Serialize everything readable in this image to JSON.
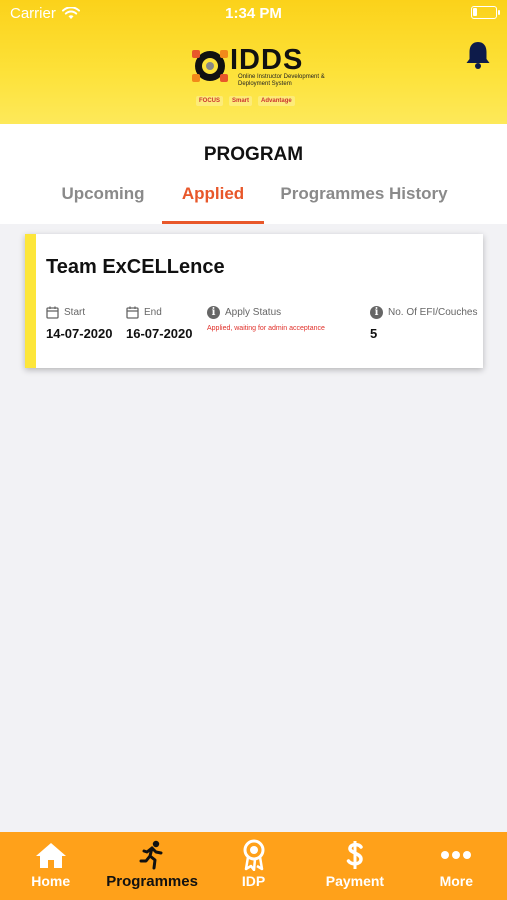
{
  "status_bar": {
    "carrier": "Carrier",
    "time": "1:34 PM",
    "battery_level": 0.2
  },
  "header": {
    "logo_title": "IDDS",
    "logo_subtitle": "Online Instructor Development & Deployment System",
    "partners": [
      "FOCUS",
      "Smart",
      "Advantage"
    ],
    "bell_icon": "bell-icon"
  },
  "page": {
    "title": "PROGRAM"
  },
  "tabs": [
    {
      "label": "Upcoming",
      "active": false
    },
    {
      "label": "Applied",
      "active": true
    },
    {
      "label": "Programmes History",
      "active": false
    }
  ],
  "card": {
    "title": "Team ExCELLence",
    "start_label": "Start",
    "start_value": "14-07-2020",
    "end_label": "End",
    "end_value": "16-07-2020",
    "status_label": "Apply Status",
    "status_value": "Applied, waiting for admin acceptance",
    "count_label": "No. Of EFI/Couches",
    "count_value": "5",
    "accent_color": "#fde63a",
    "status_color": "#e0302a"
  },
  "tabbar": [
    {
      "label": "Home",
      "icon": "home-icon",
      "active": false
    },
    {
      "label": "Programmes",
      "icon": "running-icon",
      "active": true
    },
    {
      "label": "IDP",
      "icon": "award-icon",
      "active": false
    },
    {
      "label": "Payment",
      "icon": "dollar-icon",
      "active": false
    },
    {
      "label": "More",
      "icon": "more-icon",
      "active": false
    }
  ],
  "colors": {
    "header": "#fbd21a",
    "tabbar": "#ffa11a",
    "active_tab": "#e8572a"
  }
}
